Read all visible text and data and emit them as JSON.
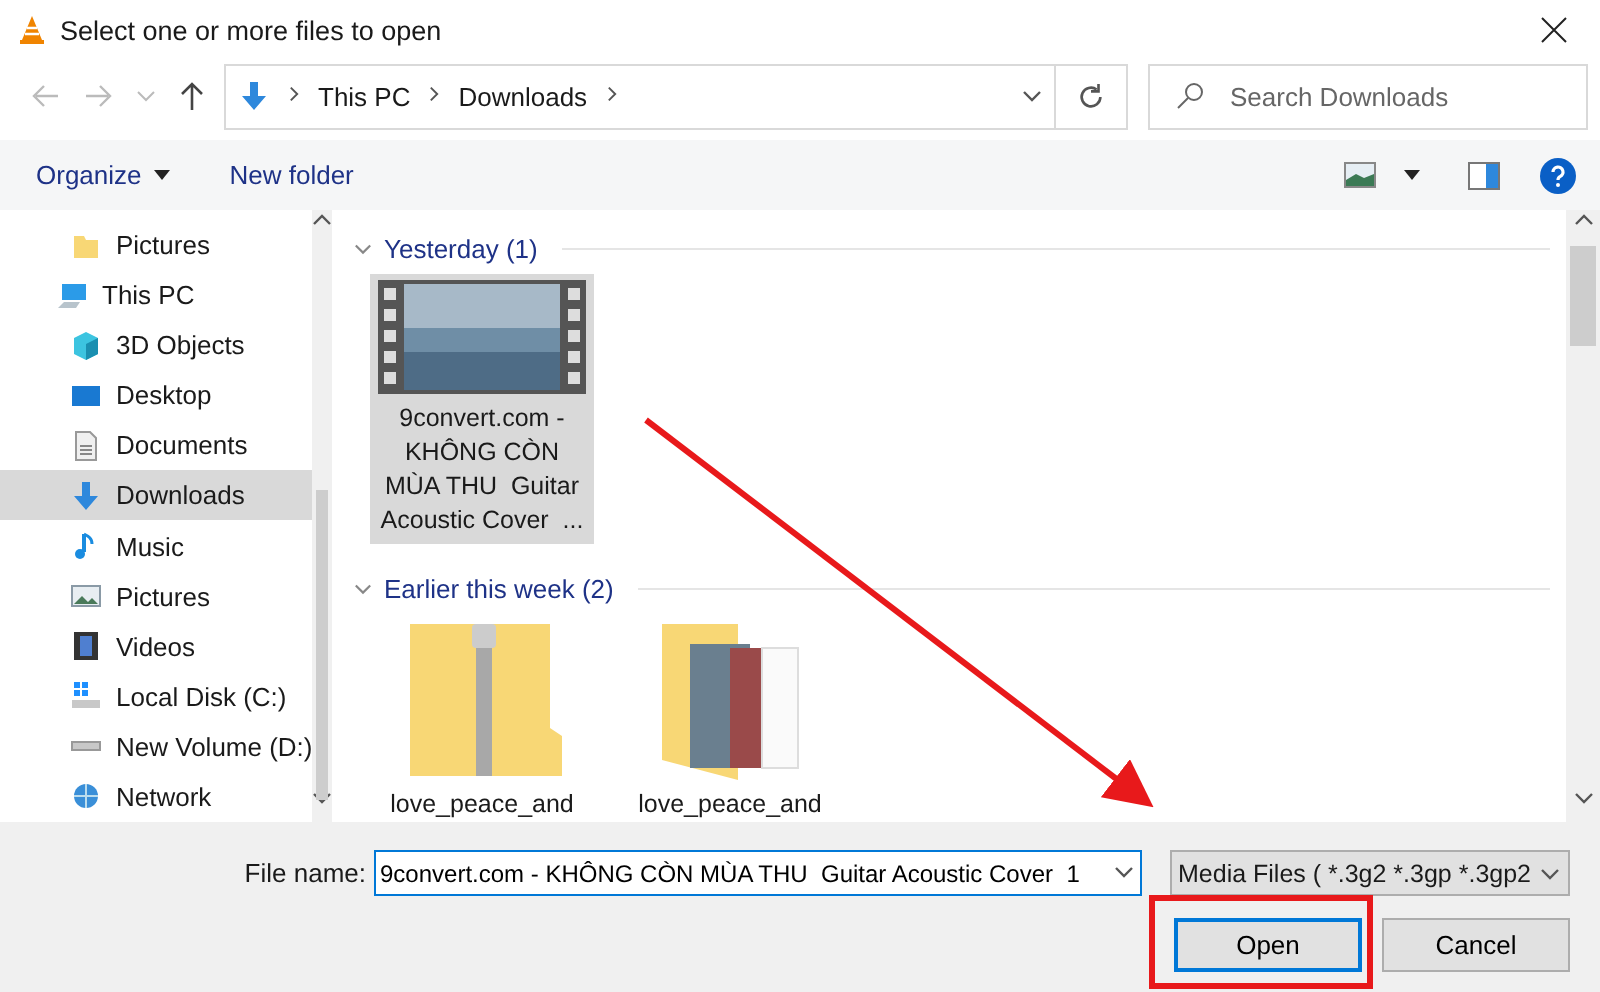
{
  "window": {
    "title": "Select one or more files to open"
  },
  "address_bar": {
    "path": [
      "This PC",
      "Downloads"
    ]
  },
  "search": {
    "placeholder": "Search Downloads"
  },
  "toolbar": {
    "buttons": [
      {
        "label": "Organize",
        "kind": "menu"
      },
      {
        "label": "New folder",
        "kind": "button"
      }
    ]
  },
  "sidebar": {
    "items": [
      {
        "label": "Pictures",
        "kind": "folder",
        "selected": false
      },
      {
        "label": "This PC",
        "kind": "pc",
        "selected": false,
        "children": [
          {
            "label": "3D Objects",
            "kind": "cube",
            "selected": false
          },
          {
            "label": "Desktop",
            "kind": "desktop",
            "selected": false
          },
          {
            "label": "Documents",
            "kind": "document",
            "selected": false
          },
          {
            "label": "Downloads",
            "kind": "download",
            "selected": true
          },
          {
            "label": "Music",
            "kind": "music",
            "selected": false
          },
          {
            "label": "Pictures",
            "kind": "pictures",
            "selected": false
          },
          {
            "label": "Videos",
            "kind": "videos",
            "selected": false
          },
          {
            "label": "Local Disk (C:)",
            "kind": "system-drive",
            "selected": false
          },
          {
            "label": "New Volume (D:)",
            "kind": "drive",
            "selected": false
          }
        ]
      },
      {
        "label": "Network",
        "kind": "network",
        "selected": false
      }
    ]
  },
  "groups": [
    {
      "label": "Yesterday (1)",
      "expanded": true,
      "files": [
        {
          "name": "9convert.com - KHÔNG CÒN MÙA THU  Guitar Acoustic Cover  ...",
          "kind": "video",
          "selected": true
        }
      ]
    },
    {
      "label": "Earlier this week (2)",
      "expanded": true,
      "files": [
        {
          "name": "love_peace_and",
          "kind": "zip",
          "selected": false
        },
        {
          "name": "love_peace_and",
          "kind": "folder",
          "selected": false
        }
      ]
    }
  ],
  "file_name": {
    "label": "File name:",
    "value": "9convert.com - KHÔNG CÒN MÙA THU  Guitar Acoustic Cover  1"
  },
  "file_type": {
    "value": "Media Files ( *.3g2 *.3gp *.3gp2"
  },
  "buttons": [
    {
      "label": "Open",
      "default": true
    },
    {
      "label": "Cancel",
      "default": false
    }
  ]
}
